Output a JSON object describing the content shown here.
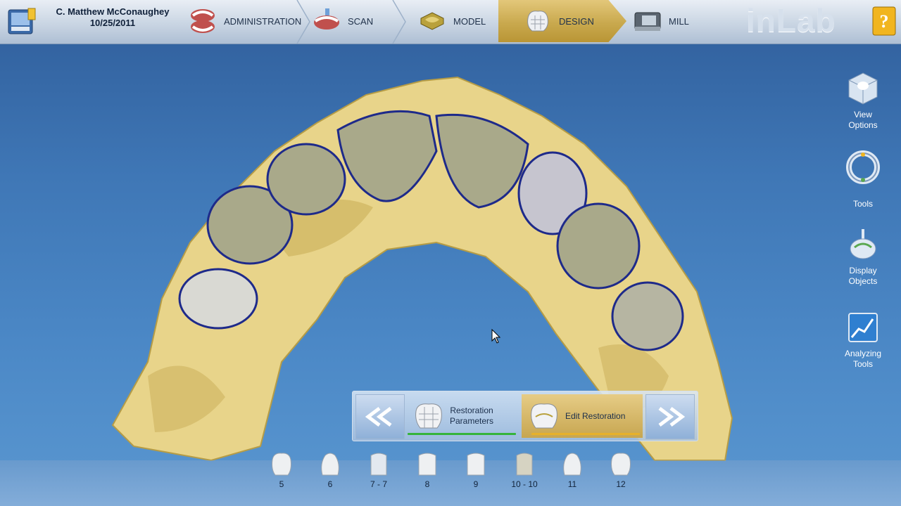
{
  "header": {
    "patient_name": "C. Matthew McConaughey",
    "date": "10/25/2011",
    "brand": "inLab",
    "steps": [
      {
        "label": "ADMINISTRATION",
        "icon": "dentures-icon",
        "active": false
      },
      {
        "label": "SCAN",
        "icon": "scan-model-icon",
        "active": false
      },
      {
        "label": "MODEL",
        "icon": "model-block-icon",
        "active": false
      },
      {
        "label": "DESIGN",
        "icon": "crown-design-icon",
        "active": true
      },
      {
        "label": "MILL",
        "icon": "milling-unit-icon",
        "active": false
      }
    ]
  },
  "right_toolbar": [
    {
      "label_line1": "View",
      "label_line2": "Options",
      "icon": "view-cube-icon"
    },
    {
      "label_line1": "",
      "label_line2": "Tools",
      "icon": "tools-ring-icon"
    },
    {
      "label_line1": "Display",
      "label_line2": "Objects",
      "icon": "display-objects-icon"
    },
    {
      "label_line1": "Analyzing",
      "label_line2": "Tools",
      "icon": "analyzing-chart-icon"
    }
  ],
  "workflow": {
    "back_icon": "double-chevron-left-icon",
    "forward_icon": "double-chevron-right-icon",
    "steps": [
      {
        "label_line1": "Restoration",
        "label_line2": "Parameters",
        "progress_color": "#35b43a",
        "active": false
      },
      {
        "label_line1": "Edit Restoration",
        "label_line2": "",
        "progress_color": "#e7b12a",
        "active": true
      }
    ]
  },
  "teeth": [
    "5",
    "6",
    "7 - 7",
    "8",
    "9",
    "10 - 10",
    "11",
    "12"
  ],
  "colors": {
    "background_top": "#2f5d9a",
    "background_bottom": "#5a97d0",
    "active_gold": "#c9a94e",
    "model_yellow": "#e8d48a",
    "crown_gray": "#a9a98a"
  }
}
